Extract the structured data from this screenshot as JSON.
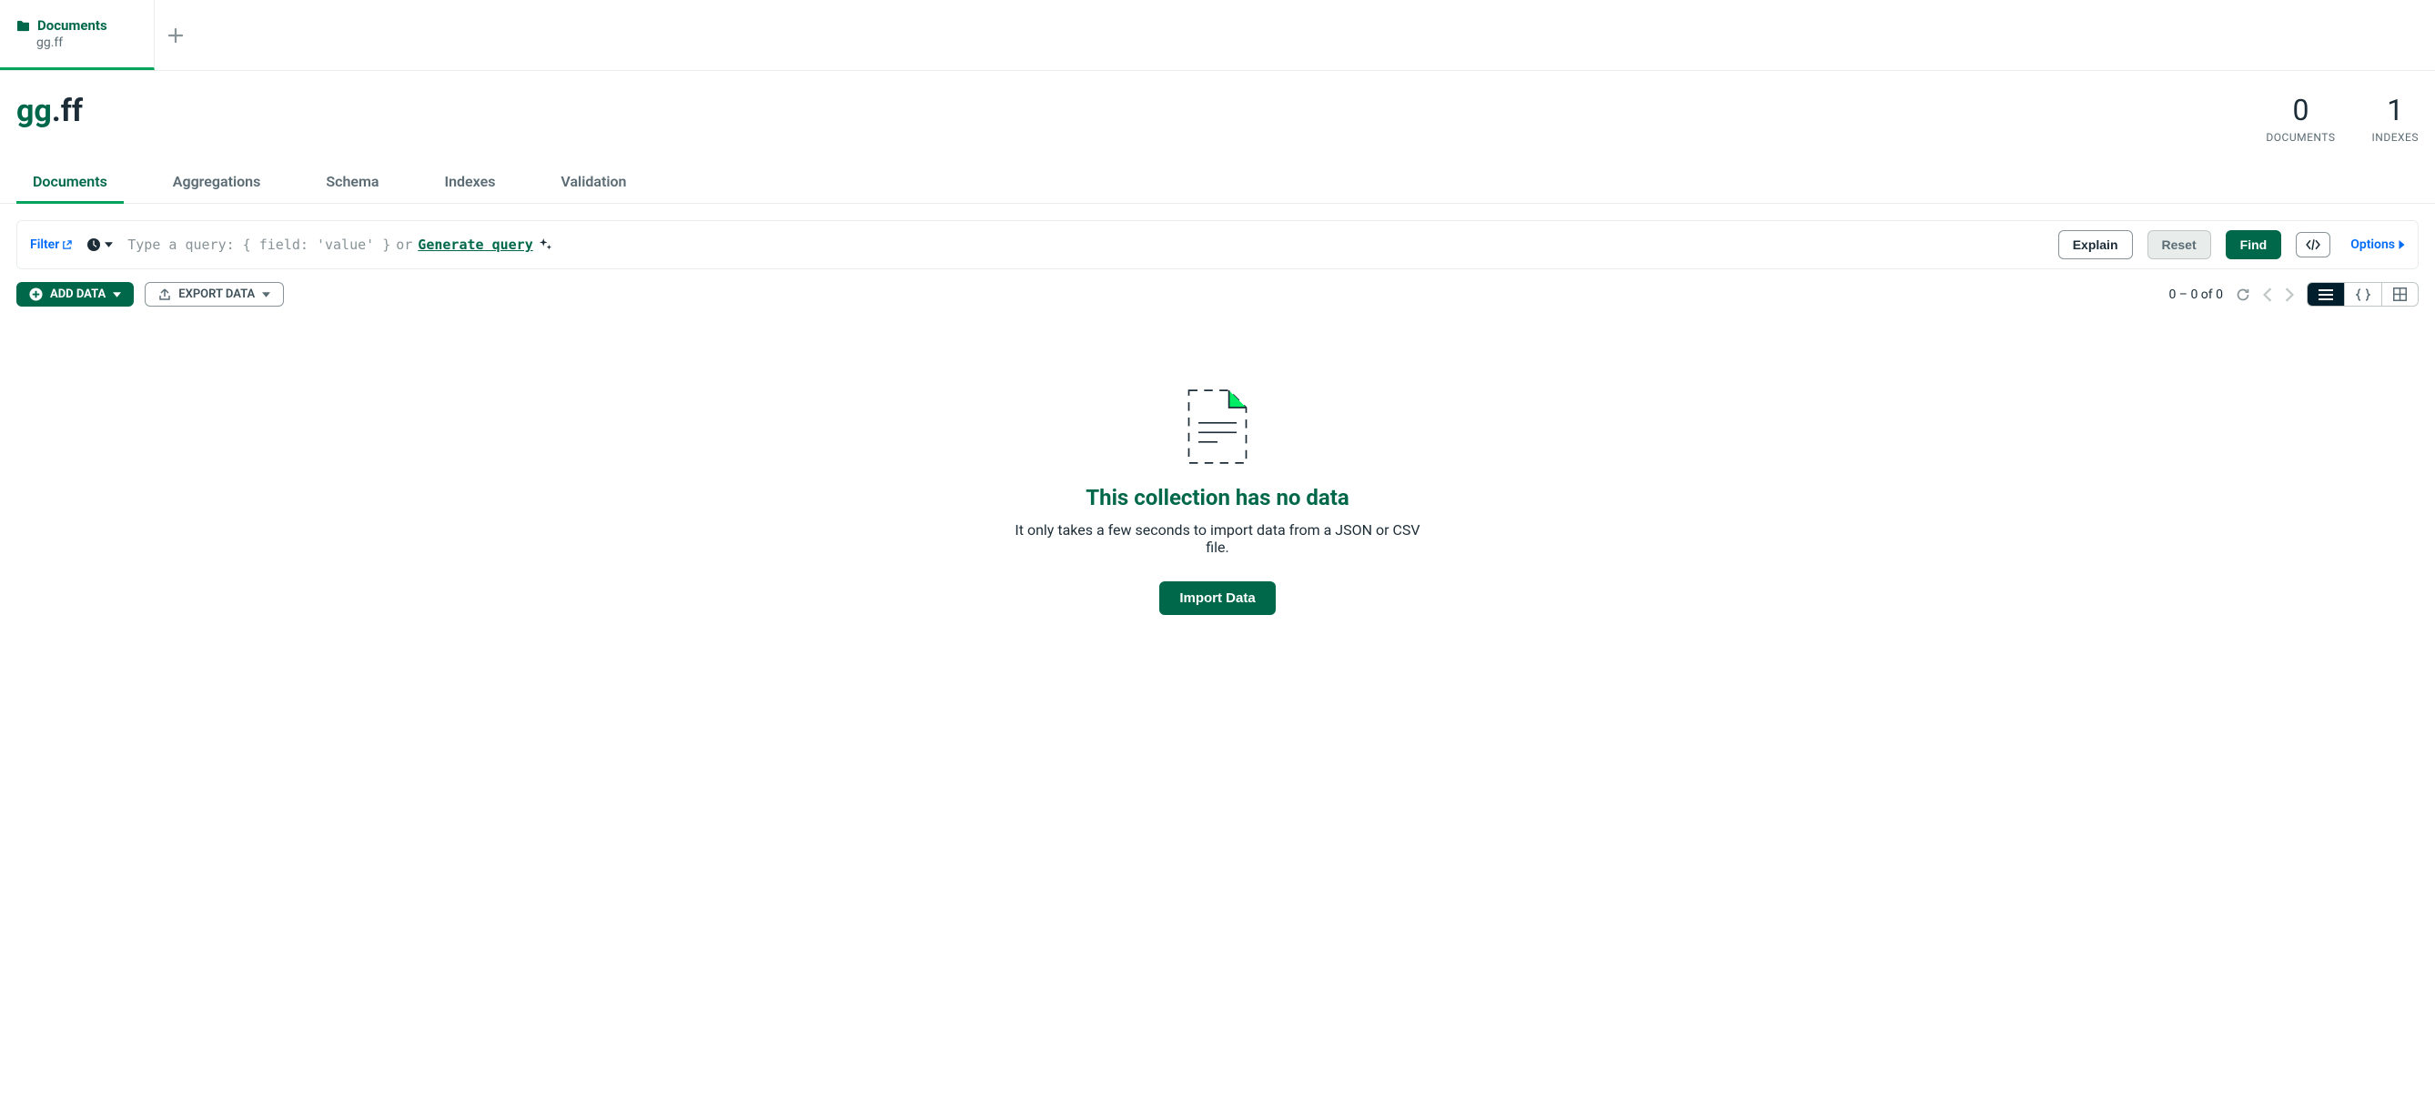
{
  "tab": {
    "title": "Documents",
    "subtitle": "gg.ff"
  },
  "namespace": {
    "db": "gg",
    "coll": ".ff"
  },
  "stats": {
    "documents_count": "0",
    "documents_label": "DOCUMENTS",
    "indexes_count": "1",
    "indexes_label": "INDEXES"
  },
  "subtabs": [
    "Documents",
    "Aggregations",
    "Schema",
    "Indexes",
    "Validation"
  ],
  "active_subtab": 0,
  "query": {
    "filter_label": "Filter",
    "placeholder_prefix": "Type a query: { field: 'value' }",
    "or_word": "or",
    "generate_label": "Generate query",
    "explain_label": "Explain",
    "reset_label": "Reset",
    "find_label": "Find",
    "options_label": "Options"
  },
  "actions": {
    "add_data_label": "ADD DATA",
    "export_label": "EXPORT DATA",
    "page_info": "0 – 0 of 0"
  },
  "empty": {
    "title": "This collection has no data",
    "subtitle": "It only takes a few seconds to import data from a JSON or CSV file.",
    "button": "Import Data"
  }
}
